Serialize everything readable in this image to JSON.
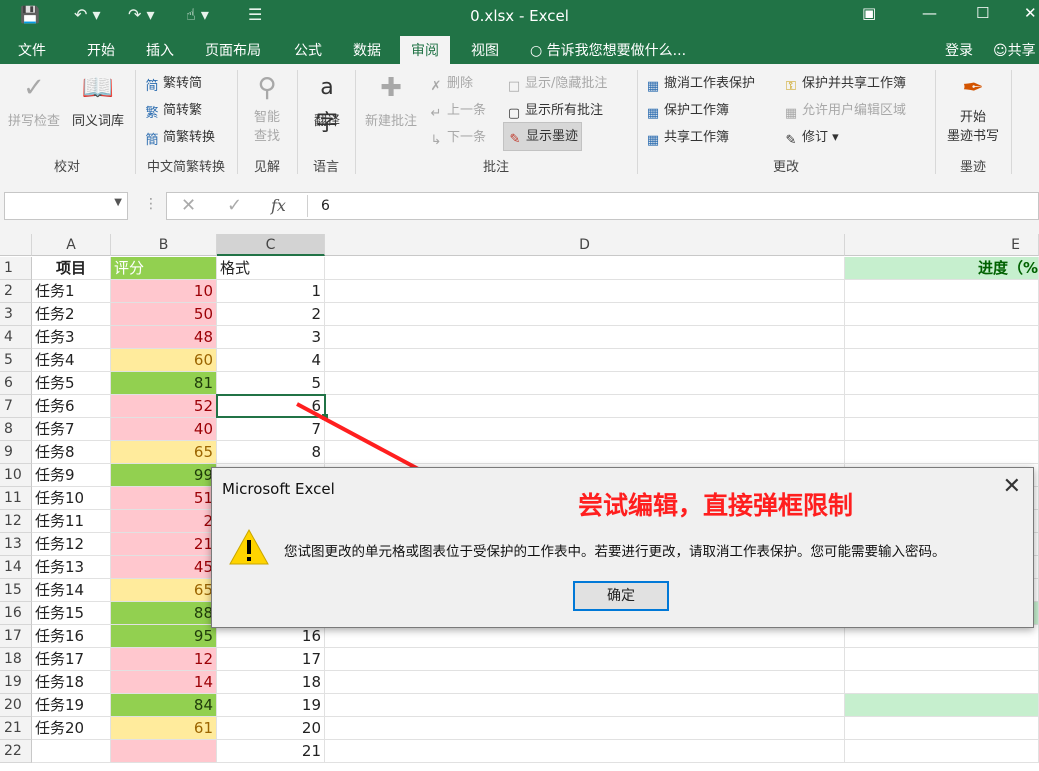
{
  "window": {
    "title": "0.xlsx - Excel"
  },
  "tabs": [
    "文件",
    "开始",
    "插入",
    "页面布局",
    "公式",
    "数据",
    "审阅",
    "视图"
  ],
  "active_tab": "审阅",
  "tell_me": "告诉我您想要做什么...",
  "login": "登录",
  "share": "共享",
  "ribbon": {
    "proofing": {
      "spell": "拼写检查",
      "thesaurus": "同义词库",
      "label": "校对"
    },
    "chinese": {
      "to_simplified": "繁转简",
      "to_traditional": "简转繁",
      "convert": "简繁转换",
      "label": "中文简繁转换"
    },
    "insights": {
      "smart_lookup": "智能\n查找",
      "label": "见解"
    },
    "language": {
      "translate": "翻译",
      "label": "语言"
    },
    "comments": {
      "new_comment": "新建批注",
      "delete": "删除",
      "previous": "上一条",
      "next": "下一条",
      "show_hide": "显示/隐藏批注",
      "show_all": "显示所有批注",
      "show_ink": "显示墨迹",
      "label": "批注"
    },
    "changes": {
      "unprotect_sheet": "撤消工作表保护",
      "protect_workbook": "保护工作簿",
      "share_workbook": "共享工作簿",
      "protect_share": "保护并共享工作簿",
      "allow_edit": "允许用户编辑区域",
      "track": "修订",
      "label": "更改"
    },
    "ink": {
      "start": "开始\n墨迹书写",
      "label": "墨迹"
    }
  },
  "formula_bar": {
    "name_box": "",
    "value": "6"
  },
  "columns": [
    "A",
    "B",
    "C",
    "D",
    "E"
  ],
  "header_row": {
    "a": "项目",
    "b": "评分",
    "c": "格式",
    "e": "进度（%"
  },
  "rows": [
    {
      "n": "2",
      "a": "任务1",
      "b": "10",
      "bc": "red",
      "c": "1"
    },
    {
      "n": "3",
      "a": "任务2",
      "b": "50",
      "bc": "red",
      "c": "2"
    },
    {
      "n": "4",
      "a": "任务3",
      "b": "48",
      "bc": "red",
      "c": "3"
    },
    {
      "n": "5",
      "a": "任务4",
      "b": "60",
      "bc": "yel",
      "c": "4"
    },
    {
      "n": "6",
      "a": "任务5",
      "b": "81",
      "bc": "grn",
      "c": "5"
    },
    {
      "n": "7",
      "a": "任务6",
      "b": "52",
      "bc": "red",
      "c": "6"
    },
    {
      "n": "8",
      "a": "任务7",
      "b": "40",
      "bc": "red",
      "c": "7"
    },
    {
      "n": "9",
      "a": "任务8",
      "b": "65",
      "bc": "yel",
      "c": "8"
    },
    {
      "n": "10",
      "a": "任务9",
      "b": "99",
      "bc": "grn",
      "c": ""
    },
    {
      "n": "11",
      "a": "任务10",
      "b": "51",
      "bc": "red",
      "c": ""
    },
    {
      "n": "12",
      "a": "任务11",
      "b": "2",
      "bc": "red",
      "c": ""
    },
    {
      "n": "13",
      "a": "任务12",
      "b": "21",
      "bc": "red",
      "c": ""
    },
    {
      "n": "14",
      "a": "任务13",
      "b": "45",
      "bc": "red",
      "c": ""
    },
    {
      "n": "15",
      "a": "任务14",
      "b": "65",
      "bc": "yel",
      "c": ""
    },
    {
      "n": "16",
      "a": "任务15",
      "b": "88",
      "bc": "grn",
      "c": ""
    },
    {
      "n": "17",
      "a": "任务16",
      "b": "95",
      "bc": "grn",
      "c": "16"
    },
    {
      "n": "18",
      "a": "任务17",
      "b": "12",
      "bc": "red",
      "c": "17"
    },
    {
      "n": "19",
      "a": "任务18",
      "b": "14",
      "bc": "red",
      "c": "18"
    },
    {
      "n": "20",
      "a": "任务19",
      "b": "84",
      "bc": "grn",
      "c": "19"
    },
    {
      "n": "21",
      "a": "任务20",
      "b": "61",
      "bc": "yel",
      "c": "20"
    },
    {
      "n": "22",
      "a": "",
      "b": "",
      "bc": "red",
      "c": "21"
    }
  ],
  "dialog": {
    "title": "Microsoft Excel",
    "message": "您试图更改的单元格或图表位于受保护的工作表中。若要进行更改，请取消工作表保护。您可能需要输入密码。",
    "ok": "确定"
  },
  "annotation": "尝试编辑，直接弹框限制",
  "colors": {
    "excel_green": "#217346",
    "bad_fill": "#ffc7ce",
    "neutral_fill": "#ffeb9c",
    "good_fill": "#92d050",
    "annotation": "#ff1f1f"
  }
}
